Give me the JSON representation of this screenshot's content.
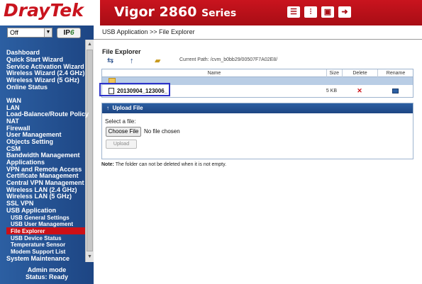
{
  "header": {
    "logo": "DrayTek",
    "model_name": "Vigor",
    "model_number": "2860",
    "model_series": "Series",
    "icons": [
      "home-icon",
      "settings-icon",
      "save-icon",
      "logout-icon"
    ]
  },
  "sidebar": {
    "mode_select": "Off",
    "ipv6_label_a": "IP",
    "ipv6_label_b": "6",
    "items": [
      "Dashboard",
      "Quick Start Wizard",
      "Service Activation Wizard",
      "Wireless Wizard (2.4 GHz)",
      "Wireless Wizard (5 GHz)",
      "Online Status",
      "WAN",
      "LAN",
      "Load-Balance/Route Policy",
      "NAT",
      "Firewall",
      "User Management",
      "Objects Setting",
      "CSM",
      "Bandwidth Management",
      "Applications",
      "VPN and Remote Access",
      "Certificate Management",
      "Central VPN Management",
      "Wireless LAN (2.4 GHz)",
      "Wireless LAN (5 GHz)",
      "SSL VPN",
      "USB Application"
    ],
    "sub_items": [
      "USB General Settings",
      "USB User Management",
      "File Explorer",
      "USB Device Status",
      "Temperature Sensor",
      "Modem Support List"
    ],
    "last_item": "System Maintenance",
    "admin_mode": "Admin mode",
    "status": "Status: Ready"
  },
  "main": {
    "breadcrumb": "USB Application >> File Explorer",
    "section_title": "File Explorer",
    "current_path": "Current Path: /cvm_b0bb29/00507F7A02E8/",
    "columns": [
      "Name",
      "Size",
      "Delete",
      "Rename"
    ],
    "files": [
      {
        "name": "20130904_123006_",
        "size": "5 KB"
      }
    ],
    "upload_title": "Upload File",
    "select_label": "Select a file:",
    "choose_button": "Choose File",
    "no_file": "No file chosen",
    "upload_button": "Upload",
    "note_label": "Note:",
    "note_text": "The folder can not be deleted when it is not empty."
  },
  "colors": {
    "brand_red": "#c9141e",
    "nav_blue": "#1d4583",
    "active_item": "#cc1017",
    "highlight_box": "#2d33c9"
  }
}
